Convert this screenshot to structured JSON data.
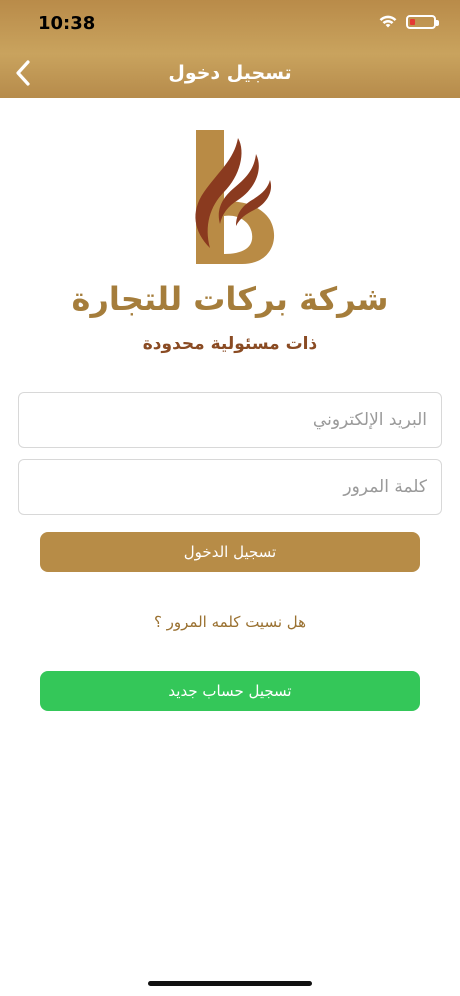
{
  "status_bar": {
    "time": "10:38",
    "icons": [
      "wifi-icon",
      "battery-low-icon"
    ]
  },
  "nav": {
    "title": "تسجيل دخول",
    "back_icon": "chevron-left-icon"
  },
  "brand": {
    "logo": "barakat-b-logo",
    "name": "شركة بركات للتجارة",
    "subtitle": "ذات مسئولية محدودة"
  },
  "form": {
    "email": {
      "value": "",
      "placeholder": "البريد الإلكتروني"
    },
    "password": {
      "value": "",
      "placeholder": "كلمة المرور"
    },
    "login_label": "تسجيل الدخول",
    "forgot_label": "هل نسيت كلمه المرور ؟",
    "register_label": "تسجيل حساب جديد"
  },
  "colors": {
    "header": "#c19a55",
    "gold": "#b78c47",
    "brown": "#8a3a1f",
    "green": "#34c759"
  }
}
